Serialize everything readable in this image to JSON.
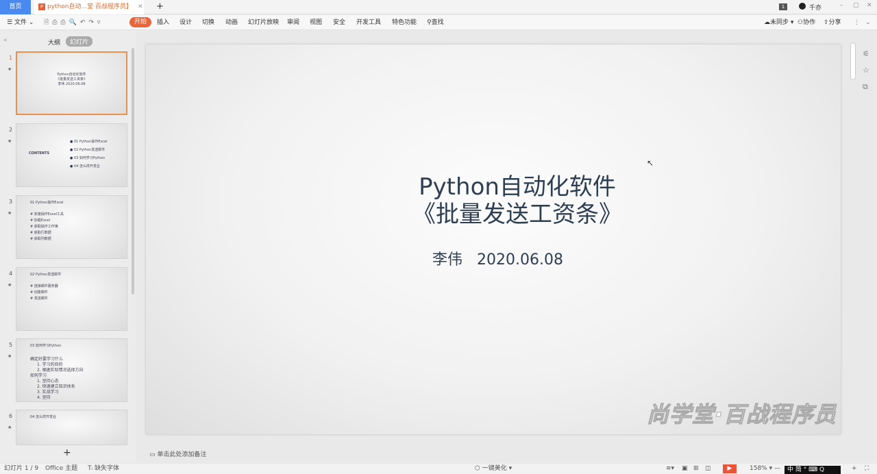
{
  "tabs": {
    "home": "首页",
    "document": "python自动...堂·百战程序员】",
    "new_tab": "+"
  },
  "window": {
    "badge": "1",
    "user": "千亦",
    "minimize": "–",
    "restore": "▢",
    "close": "✕"
  },
  "toolbar": {
    "file": "文件",
    "menu": [
      "开始",
      "插入",
      "设计",
      "切换",
      "动画",
      "幻灯片放映",
      "审阅",
      "视图",
      "安全",
      "开发工具",
      "特色功能"
    ],
    "search": "查找",
    "sync": "未同步",
    "collab": "协作",
    "share": "分享"
  },
  "panel": {
    "outline": "大纲",
    "slides": "幻灯片",
    "add": "+"
  },
  "thumbnails": [
    {
      "num": "1",
      "lines": [
        "Python自动化软件",
        "《批量发送工资条》",
        "李伟  2020.06.08"
      ]
    },
    {
      "num": "2",
      "lines": [
        "CONTENTS",
        "01 Python操作Excel",
        "02 Python发送邮件",
        "03 如何学习Python",
        "04 怎么样开发业"
      ]
    },
    {
      "num": "3",
      "lines": [
        "01 Python操作Excel",
        "# 安装操作Excel工具",
        "# 加载Excel",
        "# 获取操作工作簿",
        "# 获取行数据",
        "# 获取列数据"
      ]
    },
    {
      "num": "4",
      "lines": [
        "02 Python发送邮件",
        "# 连接邮件服务器",
        "# 创建邮件",
        "# 发送邮件"
      ]
    },
    {
      "num": "5",
      "lines": [
        "03 如何学习Python",
        "确定好要学习什么",
        "1. 学习的目的",
        "2. 根据实际情况选择方向",
        "如何学习",
        "1. 坚持心态",
        "2. 快速建立知识体系",
        "3. 实战学习",
        "4. 坚持"
      ]
    },
    {
      "num": "6",
      "lines": [
        "04 怎么样开发业"
      ]
    }
  ],
  "slide": {
    "title_line1": "Python自动化软件",
    "title_line2": "《批量发送工资条》",
    "author": "李伟",
    "date": "2020.06.08",
    "watermark": "尚学堂·百战程序员"
  },
  "notes": {
    "placeholder": "单击此处添加备注"
  },
  "status": {
    "slide_count": "幻灯片 1 / 9",
    "theme": "Office 主题",
    "missing_font": "缺失字体",
    "beautify": "一键美化",
    "zoom": "158%",
    "ime": "中 简"
  },
  "colors": {
    "accent": "#e8663a",
    "home_tab": "#4a8af0",
    "title_text": "#2f3f52"
  }
}
